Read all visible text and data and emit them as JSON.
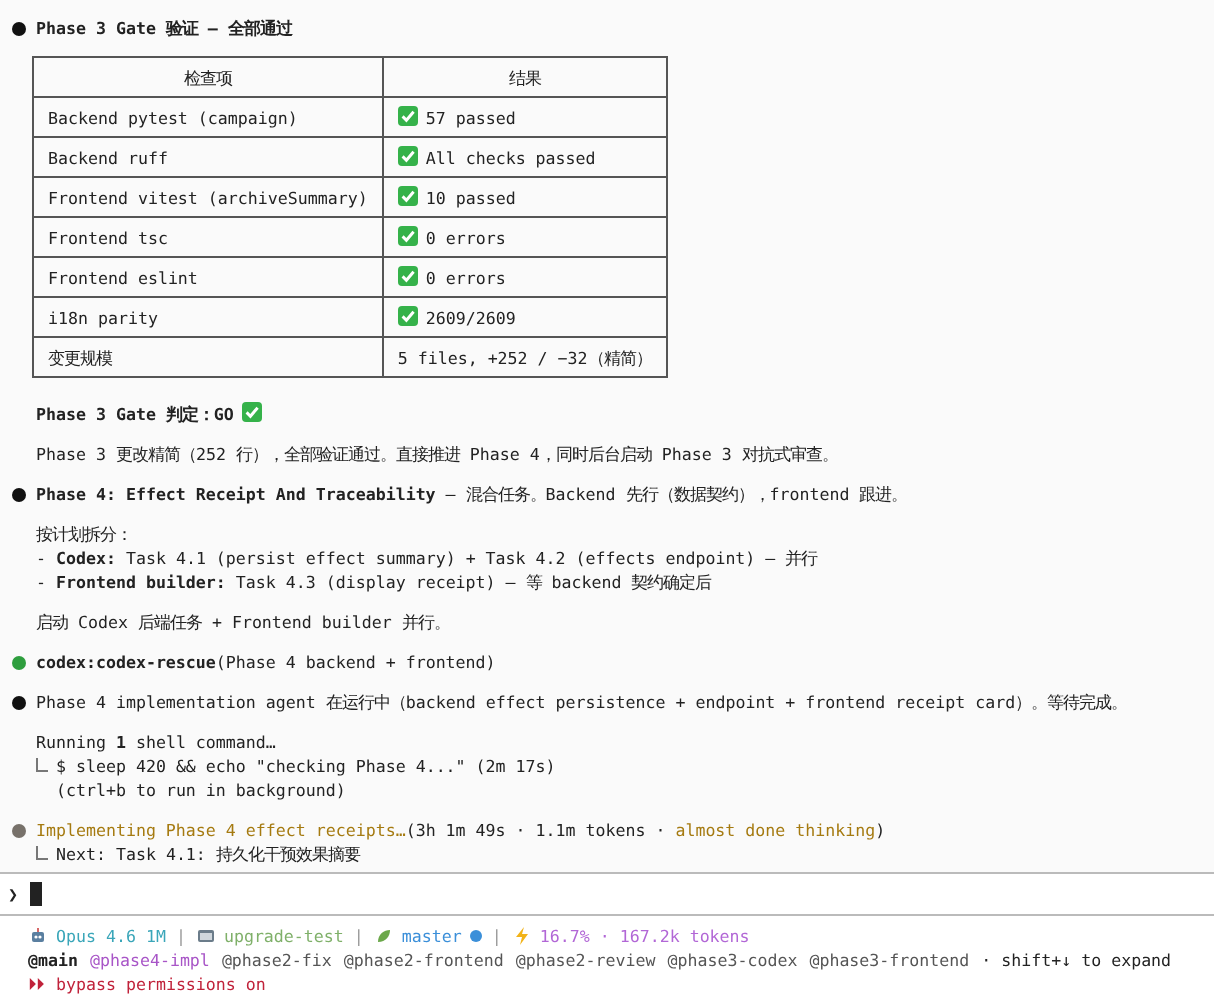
{
  "messages": [
    {
      "kind": "bullet",
      "color": "#111111",
      "bold": true,
      "text": "Phase 3 Gate 验证 – 全部通过"
    },
    {
      "kind": "table",
      "columns": [
        "检查项",
        "结果"
      ],
      "rows": [
        {
          "check": "Backend pytest (campaign)",
          "result": "57 passed",
          "passed": true
        },
        {
          "check": "Backend ruff",
          "result": "All checks passed",
          "passed": true
        },
        {
          "check": "Frontend vitest (archiveSummary)",
          "result": "10 passed",
          "passed": true
        },
        {
          "check": "Frontend tsc",
          "result": "0 errors",
          "passed": true
        },
        {
          "check": "Frontend eslint",
          "result": "0 errors",
          "passed": true
        },
        {
          "check": "i18n parity",
          "result": "2609/2609",
          "passed": true
        },
        {
          "check": "变更规模",
          "result": "5 files, +252 / −32（精简）",
          "passed": false
        }
      ]
    },
    {
      "kind": "verdict",
      "text": "Phase 3 Gate 判定：GO",
      "passed": true
    },
    {
      "kind": "text",
      "text": "Phase 3 更改精简（252 行），全部验证通过。直接推进 Phase 4，同时后台启动 Phase 3 对抗式审查。"
    },
    {
      "kind": "bullet",
      "color": "#111111",
      "bold": false,
      "text": "**Phase 4: Effect Receipt And Traceability** — 混合任务。Backend 先行（数据契约），frontend 跟进。"
    },
    {
      "kind": "lines",
      "lines": [
        "按计划拆分：",
        "- **Codex:** Task 4.1 (persist effect summary) + Task 4.2 (effects endpoint) — 并行",
        "- **Frontend builder:** Task 4.3 (display receipt) — 等 backend 契约确定后"
      ]
    },
    {
      "kind": "text",
      "text": "启动 Codex 后端任务 + Frontend builder 并行。"
    },
    {
      "kind": "bullet",
      "color": "#2e9e3e",
      "bold": false,
      "text": "**codex:codex-rescue**(Phase 4 backend + frontend)"
    },
    {
      "kind": "bullet",
      "color": "#111111",
      "bold": false,
      "text": "Phase 4 implementation agent 在运行中（backend effect persistence + endpoint + frontend receipt card）。等待完成。"
    },
    {
      "kind": "shell",
      "title": "Running **1** shell command…",
      "output": [
        "$ sleep 420 && echo \"checking Phase 4...\" (2m 17s)",
        "(ctrl+b to run in background)"
      ]
    },
    {
      "kind": "progress",
      "color": "#77716a",
      "label": "Implementing Phase 4 effect receipts…",
      "stats": "(3h 1m 49s · 1.1m tokens · ",
      "status": "almost done thinking",
      "close": ")",
      "next": "Next: Task 4.1: 持久化干预效果摘要"
    }
  ],
  "prompt": {
    "symbol": "❯"
  },
  "status_line": [
    {
      "kind": "model",
      "text": "Opus 4.6 1M",
      "color": "#3aa6b9"
    },
    {
      "kind": "sep",
      "text": "|"
    },
    {
      "kind": "folder",
      "text": "upgrade-test",
      "color": "#7fb069"
    },
    {
      "kind": "sep",
      "text": "|"
    },
    {
      "kind": "branch",
      "text": "master",
      "color": "#3b8fd9"
    },
    {
      "kind": "sep",
      "text": "|"
    },
    {
      "kind": "usage",
      "text": "16.7% · 167.2k tokens",
      "color": "#b267d6"
    }
  ],
  "agents": [
    {
      "text": "@main",
      "selected": true,
      "color": "#222222"
    },
    {
      "text": "@phase4-impl",
      "selected": false,
      "color": "#a855c7"
    },
    {
      "text": "@phase2-fix",
      "selected": false,
      "color": "#555555"
    },
    {
      "text": "@phase2-frontend",
      "selected": false,
      "color": "#555555"
    },
    {
      "text": "@phase2-review",
      "selected": false,
      "color": "#555555"
    },
    {
      "text": "@phase3-codex",
      "selected": false,
      "color": "#555555"
    },
    {
      "text": "@phase3-frontend",
      "selected": false,
      "color": "#555555"
    }
  ],
  "agents_hint": "· shift+↓ to expand",
  "mode": {
    "symbol": "⏵⏵",
    "text": "bypass permissions on"
  }
}
